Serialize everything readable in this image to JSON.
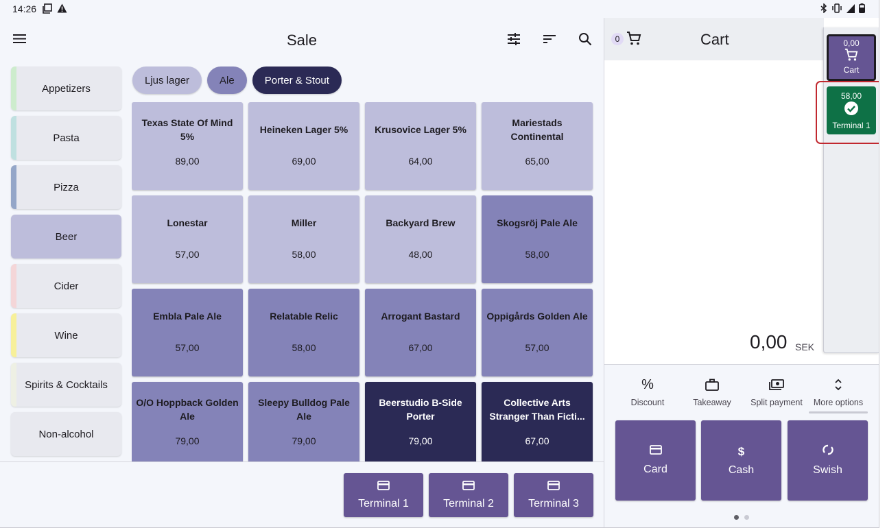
{
  "status_bar": {
    "time": "14:26",
    "left_icons": [
      "screenshot-icon",
      "warning-icon"
    ],
    "right_icons": [
      "bluetooth-icon",
      "vibrate-icon",
      "signal-icon",
      "battery-icon"
    ]
  },
  "app_bar": {
    "title": "Sale",
    "icons": [
      "menu-icon",
      "tune-icon",
      "sort-icon",
      "search-icon"
    ]
  },
  "categories": [
    {
      "label": "Appetizers",
      "stripe_color": "#cdeccd",
      "active": false
    },
    {
      "label": "Pasta",
      "stripe_color": "#bfe0e0",
      "active": false
    },
    {
      "label": "Pizza",
      "stripe_color": "#94a6c8",
      "active": false
    },
    {
      "label": "Beer",
      "stripe_color": "#bdbddb",
      "active": true
    },
    {
      "label": "Cider",
      "stripe_color": "#f4d6d8",
      "active": false
    },
    {
      "label": "Wine",
      "stripe_color": "#f7f09a",
      "active": false
    },
    {
      "label": "Spirits & Cocktails",
      "stripe_color": "#eef0e4",
      "active": false
    },
    {
      "label": "Non-alcohol",
      "stripe_color": "#e8e9ef",
      "active": false
    }
  ],
  "chips": [
    {
      "label": "Ljus lager",
      "bg": "#bdbddb",
      "fg": "#1d1b20"
    },
    {
      "label": "Ale",
      "bg": "#8483b8",
      "fg": "#1d1b20"
    },
    {
      "label": "Porter & Stout",
      "bg": "#2b2a55",
      "fg": "#ffffff"
    }
  ],
  "products": [
    {
      "name": "Texas State Of Mind 5%",
      "price": "89,00",
      "tone": "c1"
    },
    {
      "name": "Heineken Lager 5%",
      "price": "69,00",
      "tone": "c1"
    },
    {
      "name": "Krusovice Lager 5%",
      "price": "64,00",
      "tone": "c1"
    },
    {
      "name": "Mariestads Continental",
      "price": "65,00",
      "tone": "c1"
    },
    {
      "name": "Lonestar",
      "price": "57,00",
      "tone": "c1"
    },
    {
      "name": "Miller",
      "price": "58,00",
      "tone": "c1"
    },
    {
      "name": "Backyard Brew",
      "price": "48,00",
      "tone": "c1"
    },
    {
      "name": "Skogsröj Pale Ale",
      "price": "58,00",
      "tone": "c2"
    },
    {
      "name": "Embla Pale Ale",
      "price": "57,00",
      "tone": "c2"
    },
    {
      "name": "Relatable Relic",
      "price": "58,00",
      "tone": "c2"
    },
    {
      "name": "Arrogant Bastard",
      "price": "67,00",
      "tone": "c2"
    },
    {
      "name": "Oppigårds Golden Ale",
      "price": "57,00",
      "tone": "c2"
    },
    {
      "name": "O/O Hoppback Golden Ale",
      "price": "79,00",
      "tone": "c2"
    },
    {
      "name": "Sleepy Bulldog Pale Ale",
      "price": "79,00",
      "tone": "c2"
    },
    {
      "name": "Beerstudio B-Side Porter",
      "price": "79,00",
      "tone": "c3"
    },
    {
      "name": "Collective Arts Stranger Than Ficti...",
      "price": "67,00",
      "tone": "c3"
    }
  ],
  "terminal_buttons": [
    {
      "label": "Terminal 1",
      "icon": "card-icon"
    },
    {
      "label": "Terminal 2",
      "icon": "card-icon"
    },
    {
      "label": "Terminal 3",
      "icon": "card-icon"
    }
  ],
  "cart": {
    "title": "Cart",
    "count": "0",
    "total": "0,00",
    "currency": "SEK",
    "actions": [
      {
        "label": "Discount",
        "icon": "percent-icon"
      },
      {
        "label": "Takeaway",
        "icon": "briefcase-icon"
      },
      {
        "label": "Split payment",
        "icon": "split-payment-icon"
      },
      {
        "label": "More options",
        "icon": "expand-icon"
      }
    ],
    "payments": [
      {
        "label": "Card",
        "icon": "card-icon"
      },
      {
        "label": "Cash",
        "icon": "dollar-icon"
      },
      {
        "label": "Swish",
        "icon": "swish-icon"
      }
    ],
    "page_dots": 2,
    "active_page": 0
  },
  "side_rail": {
    "cart": {
      "amount": "0,00",
      "label": "Cart"
    },
    "terminal": {
      "amount": "58,00",
      "label": "Terminal 1",
      "color": "#0e7146"
    }
  },
  "colors": {
    "accent": "#655593",
    "highlight": "#c1282f"
  }
}
